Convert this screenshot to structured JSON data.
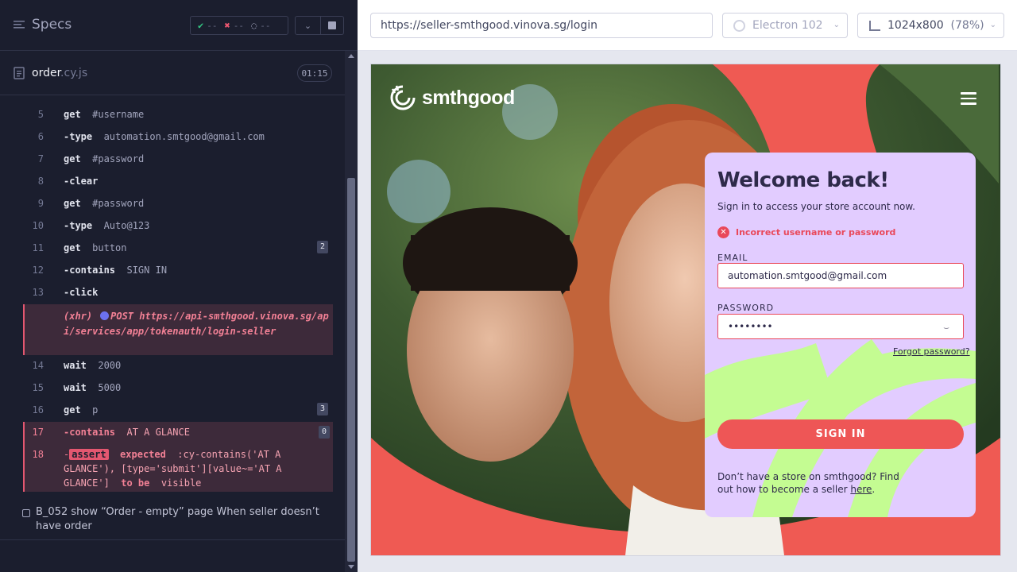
{
  "sidebar": {
    "specs_title": "Specs",
    "stats": {
      "passed": "--",
      "failed": "--",
      "pending": "--"
    },
    "spec_file": {
      "name": "order",
      "ext": ".cy.js",
      "duration": "01:15"
    },
    "commands": [
      {
        "num": "5",
        "name": "get",
        "arg": "#username",
        "badge": ""
      },
      {
        "num": "6",
        "name": "-type",
        "arg": "automation.smtgood@gmail.com",
        "badge": ""
      },
      {
        "num": "7",
        "name": "get",
        "arg": "#password",
        "badge": ""
      },
      {
        "num": "8",
        "name": "-clear",
        "arg": "",
        "badge": ""
      },
      {
        "num": "9",
        "name": "get",
        "arg": "#password",
        "badge": ""
      },
      {
        "num": "10",
        "name": "-type",
        "arg": "Auto@123",
        "badge": ""
      },
      {
        "num": "11",
        "name": "get",
        "arg": "button",
        "badge": "2"
      },
      {
        "num": "12",
        "name": "-contains",
        "arg": "SIGN IN",
        "badge": ""
      },
      {
        "num": "13",
        "name": "-click",
        "arg": "",
        "badge": ""
      },
      {
        "num": "14",
        "name": "wait",
        "arg": "2000",
        "badge": ""
      },
      {
        "num": "15",
        "name": "wait",
        "arg": "5000",
        "badge": ""
      },
      {
        "num": "16",
        "name": "get",
        "arg": "p",
        "badge": "3"
      },
      {
        "num": "17",
        "name": "-contains",
        "arg": "AT A GLANCE",
        "badge": "0"
      }
    ],
    "xhr": {
      "label": "(xhr)",
      "method": "POST",
      "url": "https://api-smthgood.vinova.sg/api/services/app/tokenauth/login-seller"
    },
    "assert": {
      "num": "18",
      "dash": "-",
      "tag": "assert",
      "expected": "expected",
      "selector": ":cy-contains('AT A GLANCE'), [type='submit'][value~='AT A GLANCE']",
      "to_be": "to be",
      "visible": "visible"
    },
    "test_title": "B_052 show “Order - empty” page When seller doesn’t have order"
  },
  "toolbar": {
    "url": "https://seller-smthgood.vinova.sg/login",
    "browser": "Electron 102",
    "viewport": "1024x800",
    "zoom": "(78%)"
  },
  "app": {
    "logo_text": "smthgood",
    "title": "Welcome back!",
    "subtitle": "Sign in to access your store account now.",
    "error": "Incorrect username or password",
    "email_label": "EMAIL",
    "email_value": "automation.smtgood@gmail.com",
    "password_label": "PASSWORD",
    "password_value": "••••••••",
    "forgot": "Forgot password?",
    "signin": "SIGN IN",
    "no_store": "Don’t have a store on smthgood? Find out how to become a seller",
    "here": "here",
    "period": "."
  },
  "colors": {
    "accent_pass": "#34c784",
    "accent_fail": "#f15872",
    "brand_coral": "#ee5656",
    "card_lilac": "#e2ccff",
    "brand_lime": "#c4fc92"
  }
}
